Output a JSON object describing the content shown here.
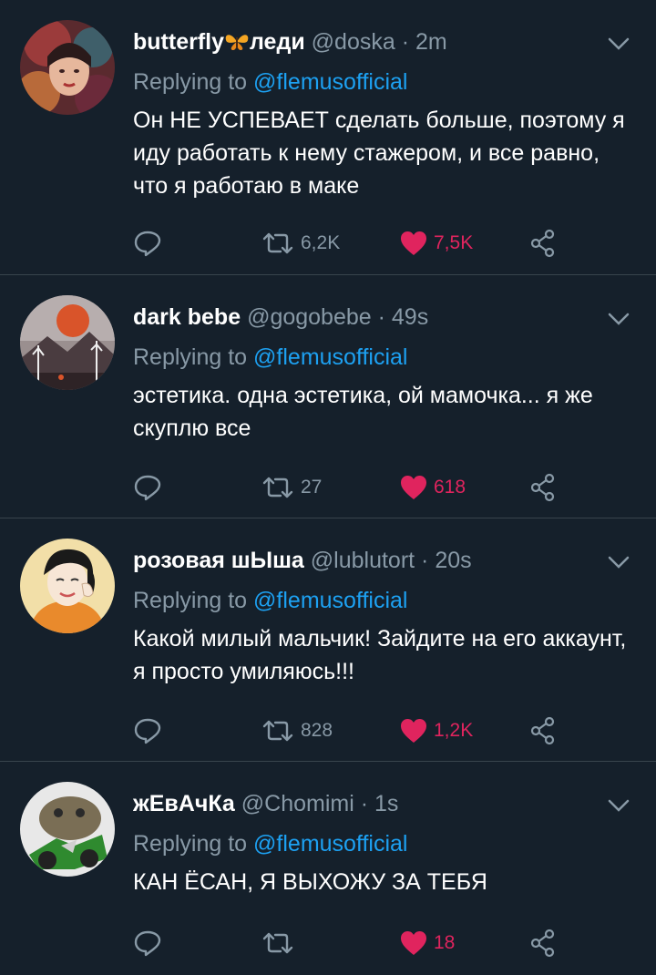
{
  "reply_prefix": "Replying to",
  "colors": {
    "background": "#15202b",
    "secondary_text": "#8899a6",
    "link": "#1da1f2",
    "like": "#e0245e",
    "divider": "#38444d"
  },
  "tweets": [
    {
      "name": "butterfly",
      "name_emoji": "butterfly-emoji",
      "name_suffix": "леди",
      "handle": "@doska",
      "time": "2m",
      "mention": "@flemusofficial",
      "text": "Он НЕ УСПЕВАЕТ сделать больше, поэтому я иду работать к нему стажером, и все равно, что я работаю в маке",
      "retweets": "6,2K",
      "likes": "7,5K",
      "liked": true
    },
    {
      "name": "dark bebe",
      "handle": "@gogobebe",
      "time": "49s",
      "mention": "@flemusofficial",
      "text": "эстетика. одна эстетика, ой мамочка... я же скуплю все",
      "retweets": "27",
      "likes": "618",
      "liked": true
    },
    {
      "name": "розовая шЫша",
      "handle": "@lublutort",
      "time": "20s",
      "mention": "@flemusofficial",
      "text": "Какой милый мальчик! Зайдите на его аккаунт, я просто умиляюсь!!!",
      "retweets": "828",
      "likes": "1,2K",
      "liked": true
    },
    {
      "name": "жЕвАчКа",
      "handle": "@Chomimi",
      "time": "1s",
      "mention": "@flemusofficial",
      "text": "КАН ЁСАН, Я ВЫХОЖУ ЗА ТЕБЯ",
      "retweets": "",
      "likes": "18",
      "liked": true
    }
  ]
}
